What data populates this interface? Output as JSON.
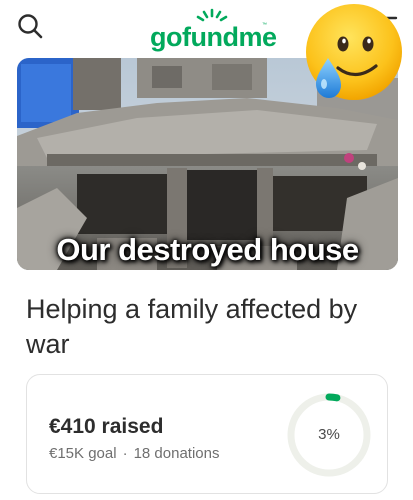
{
  "header": {
    "logo_text": "gofundme",
    "logo_tm": "™",
    "search_icon": "search-icon",
    "menu_icon": "menu-icon",
    "brand_color": "#02a95c"
  },
  "overlay": {
    "emoji_icon": "crying-face-emoji-icon"
  },
  "hero": {
    "caption": "Our destroyed house"
  },
  "campaign": {
    "title": "Helping a family affected by war"
  },
  "donation_card": {
    "raised": "€410 raised",
    "goal": "€15K goal",
    "separator": "·",
    "donations": "18 donations",
    "progress_label": "3%",
    "progress_fraction": 0.03
  }
}
